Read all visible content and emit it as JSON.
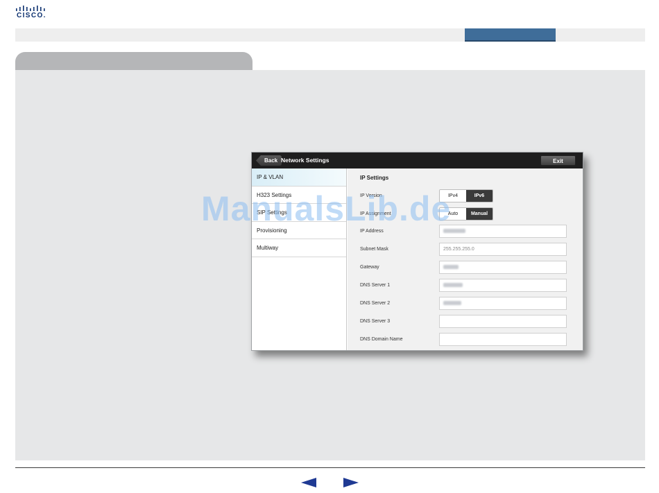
{
  "brand": {
    "logo_text": "CISCO."
  },
  "device": {
    "header": {
      "back_label": "Back",
      "title": "Network Settings",
      "exit_label": "Exit"
    },
    "sidebar": {
      "items": [
        {
          "label": "IP & VLAN",
          "active": true
        },
        {
          "label": "H323 Settings"
        },
        {
          "label": "SIP Settings"
        },
        {
          "label": "Provisioning"
        },
        {
          "label": "Multiway"
        }
      ]
    },
    "main": {
      "section_title": "IP Settings",
      "ip_version": {
        "label": "IP Version",
        "options": [
          "IPv4",
          "IPv6"
        ],
        "selected": "IPv6"
      },
      "ip_assignment": {
        "label": "IP Assignment",
        "options": [
          "Auto",
          "Manual"
        ],
        "selected": "Manual"
      },
      "fields": [
        {
          "label": "IP Address",
          "value": ""
        },
        {
          "label": "Subnet Mask",
          "value": "255.255.255.0"
        },
        {
          "label": "Gateway",
          "value": ""
        },
        {
          "label": "DNS Server 1",
          "value": ""
        },
        {
          "label": "DNS Server 2",
          "value": ""
        },
        {
          "label": "DNS Server 3",
          "value": ""
        },
        {
          "label": "DNS Domain Name",
          "value": ""
        }
      ]
    }
  },
  "watermark": "ManualsLib.de",
  "colors": {
    "accent": "#3f6d99",
    "content_bg": "#e6e7e8",
    "watermark": "#8cbef0"
  }
}
